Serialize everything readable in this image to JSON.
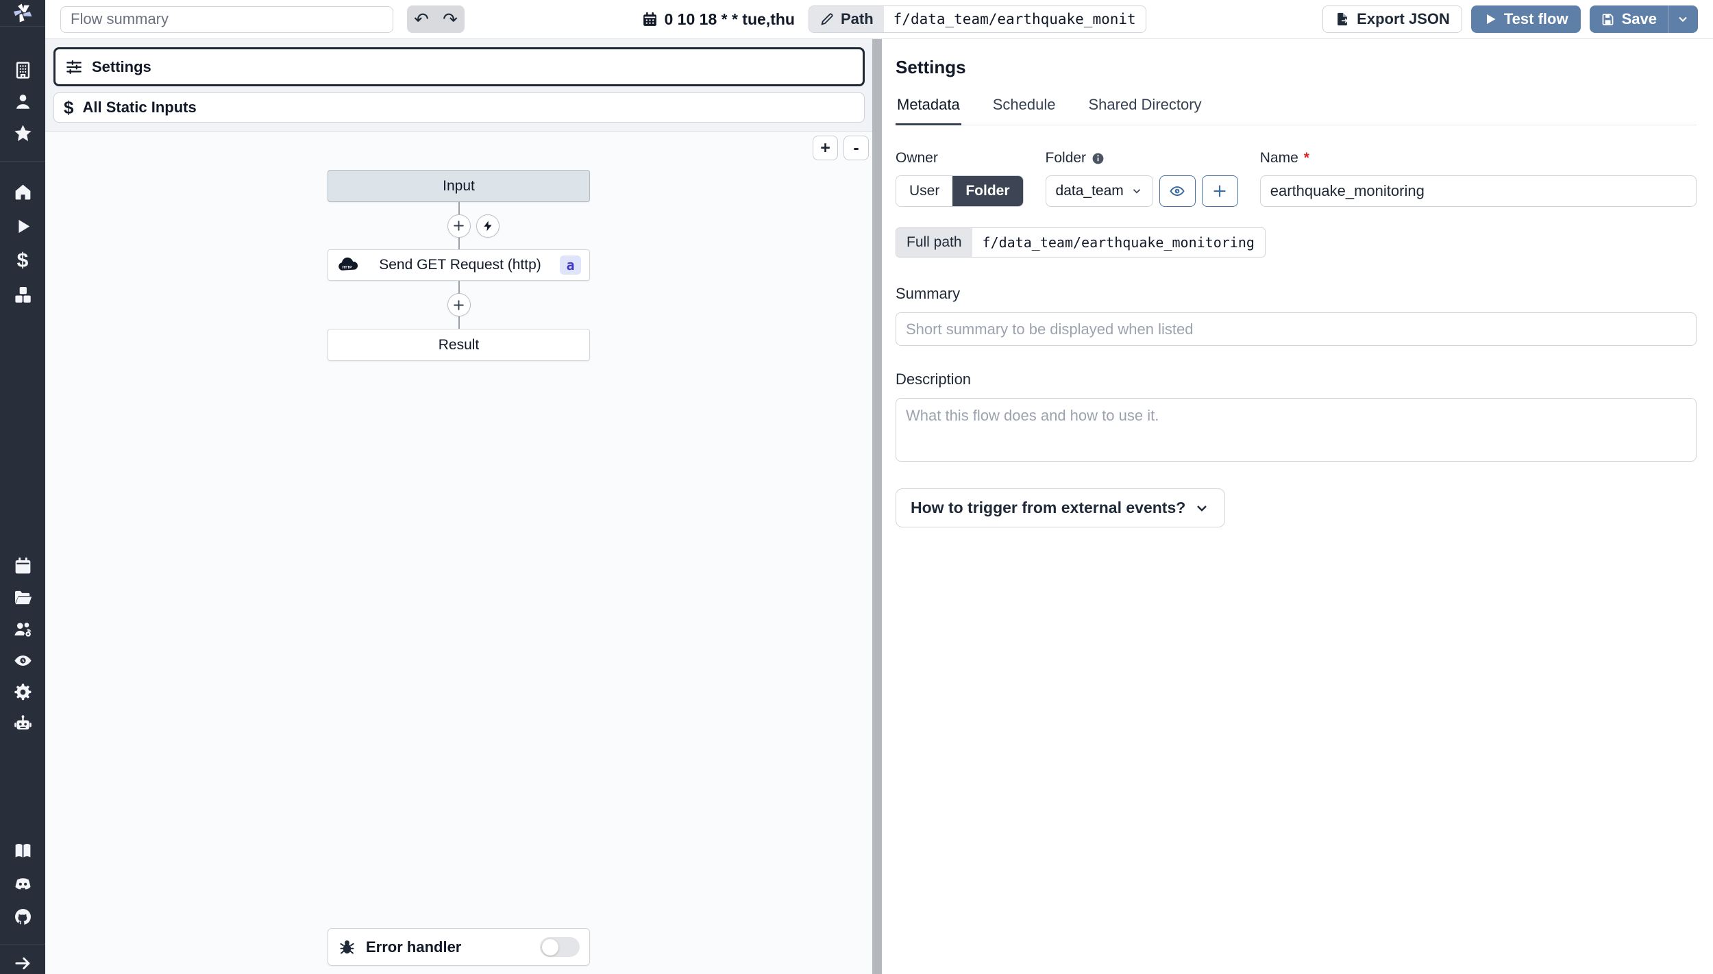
{
  "colors": {
    "accent": "#5e80a8",
    "sidebar_bg": "#282e3a",
    "dark_text": "#1f2937",
    "step_badge_bg": "#dfe4fb",
    "step_badge_text": "#4338ca"
  },
  "topbar": {
    "flow_summary_placeholder": "Flow summary",
    "schedule_cron": "0 10 18 * * tue,thu",
    "path_label": "Path",
    "path_value": "f/data_team/earthquake_monit",
    "export_json_label": "Export JSON",
    "test_flow_label": "Test flow",
    "save_label": "Save"
  },
  "flow_panel": {
    "settings_item": "Settings",
    "static_inputs_item": "All Static Inputs",
    "zoom_in": "+",
    "zoom_out": "-",
    "graph": {
      "input_node": "Input",
      "step_node": "Send GET Request (http)",
      "step_badge": "a",
      "result_node": "Result"
    },
    "error_handler_label": "Error handler"
  },
  "settings_panel": {
    "title": "Settings",
    "tabs": [
      {
        "label": "Metadata"
      },
      {
        "label": "Schedule"
      },
      {
        "label": "Shared Directory"
      }
    ],
    "owner_label": "Owner",
    "owner_user": "User",
    "owner_folder": "Folder",
    "folder_label": "Folder",
    "folder_value": "data_team",
    "name_label": "Name",
    "name_required": "*",
    "name_value": "earthquake_monitoring",
    "full_path_label": "Full path",
    "full_path_value": "f/data_team/earthquake_monitoring",
    "summary_label": "Summary",
    "summary_placeholder": "Short summary to be displayed when listed",
    "description_label": "Description",
    "description_placeholder": "What this flow does and how to use it.",
    "trigger_label": "How to trigger from external events?"
  }
}
